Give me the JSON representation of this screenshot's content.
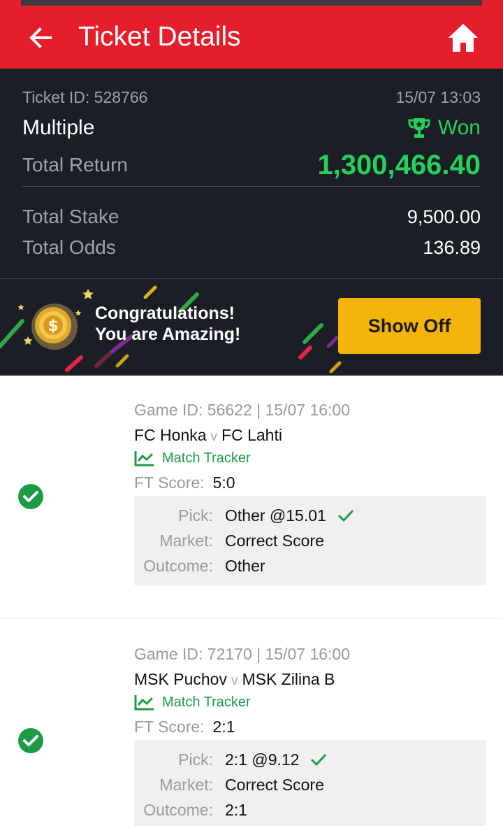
{
  "appbar": {
    "title": "Ticket Details"
  },
  "ticket": {
    "id_label": "Ticket ID: 528766",
    "datetime": "15/07 13:03",
    "type": "Multiple",
    "status": "Won",
    "total_return_label": "Total Return",
    "total_return": "1,300,466.40",
    "total_stake_label": "Total Stake",
    "total_stake": "9,500.00",
    "total_odds_label": "Total Odds",
    "total_odds": "136.89"
  },
  "banner": {
    "line1": "Congratulations!",
    "line2": "You are Amazing!",
    "button": "Show Off"
  },
  "games": [
    {
      "meta": "Game ID: 56622 | 15/07 16:00",
      "home": "FC Honka",
      "vs": "v",
      "away": "FC Lahti",
      "tracker": "Match Tracker",
      "ft_label": "FT Score:",
      "ft_score": "5:0",
      "pick_label": "Pick:",
      "pick": "Other @15.01",
      "market_label": "Market:",
      "market": "Correct Score",
      "outcome_label": "Outcome:",
      "outcome": "Other"
    },
    {
      "meta": "Game ID: 72170 | 15/07 16:00",
      "home": "MSK Puchov",
      "vs": "v",
      "away": "MSK Zilina B",
      "tracker": "Match Tracker",
      "ft_label": "FT Score:",
      "ft_score": "2:1",
      "pick_label": "Pick:",
      "pick": "2:1 @9.12",
      "market_label": "Market:",
      "market": "Correct Score",
      "outcome_label": "Outcome:",
      "outcome": "2:1"
    }
  ],
  "colors": {
    "brand_red": "#e41e2b",
    "won_green": "#27d05a",
    "tracker_green": "#1c9b46",
    "button_yellow": "#f5b40a",
    "dark_bg": "#1b1e24"
  }
}
